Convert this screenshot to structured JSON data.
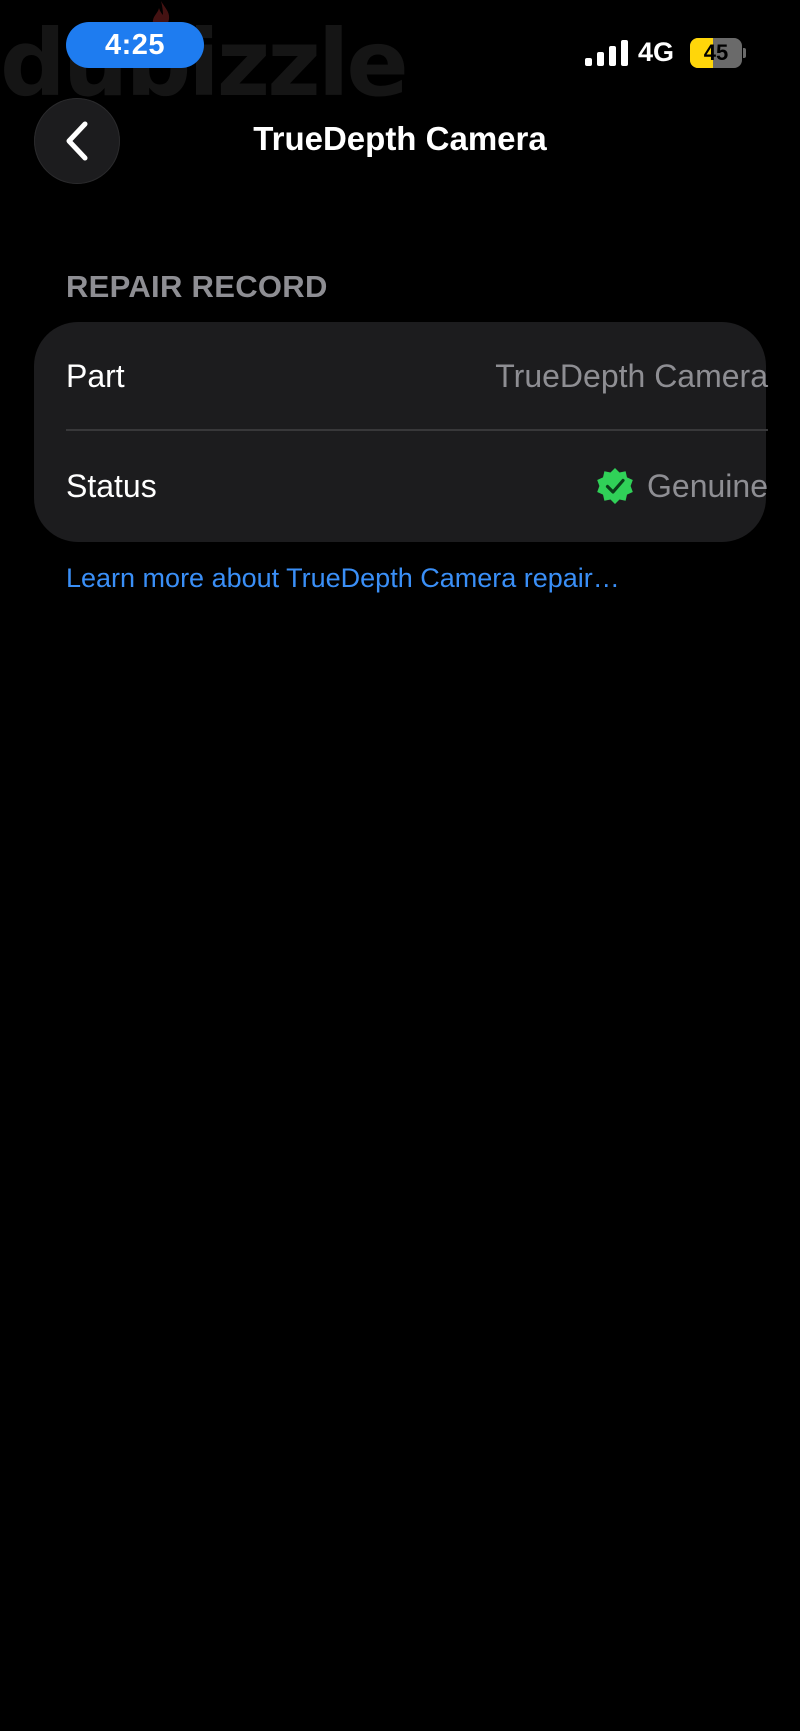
{
  "watermark": {
    "text": "dubizzle"
  },
  "status_bar": {
    "time": "4:25",
    "network": "4G",
    "battery_level": "45",
    "battery_fraction": 0.45,
    "time_pill_color": "#1e7cf0",
    "battery_color": "#ffd60a",
    "signal_bars": 4
  },
  "nav": {
    "back_icon": "chevron-left-icon",
    "title": "TrueDepth Camera"
  },
  "repair_record": {
    "header": "REPAIR RECORD",
    "rows": [
      {
        "label": "Part",
        "value": "TrueDepth Camera"
      },
      {
        "label": "Status",
        "value": "Genuine",
        "icon": "verified-badge-icon",
        "icon_color": "#30d158"
      }
    ]
  },
  "link": {
    "text": "Learn more about TrueDepth Camera repair…",
    "color": "#3a8ff7"
  }
}
